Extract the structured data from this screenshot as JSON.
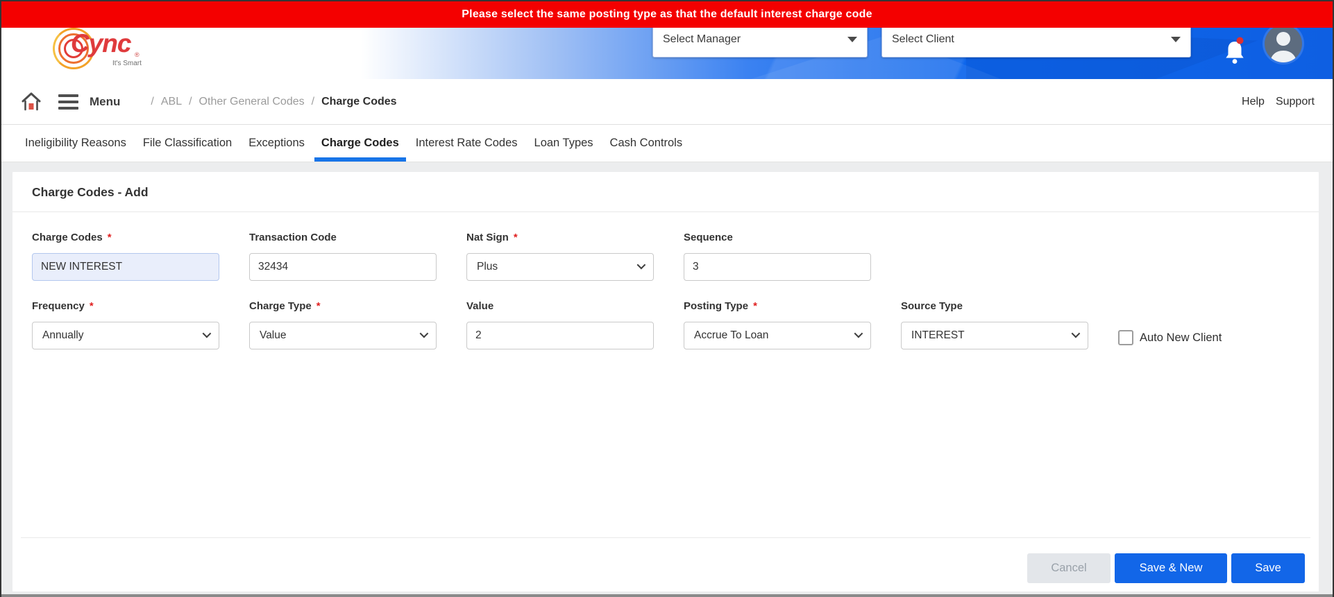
{
  "banner": {
    "message": "Please select the same posting type as that the default interest charge code"
  },
  "header": {
    "logo": {
      "brand": "Cync",
      "registered": "®",
      "tagline": "It's Smart"
    },
    "manager_select": {
      "value": "Select Manager"
    },
    "client_select": {
      "value": "Select Client"
    }
  },
  "breadcrumb": {
    "menu_label": "Menu",
    "separator": "/",
    "items": [
      {
        "label": "ABL"
      },
      {
        "label": "Other General Codes"
      },
      {
        "label": "Charge Codes"
      }
    ],
    "help": "Help",
    "support": "Support"
  },
  "tabs": [
    {
      "label": "Ineligibility Reasons",
      "active": false
    },
    {
      "label": "File Classification",
      "active": false
    },
    {
      "label": "Exceptions",
      "active": false
    },
    {
      "label": "Charge Codes",
      "active": true
    },
    {
      "label": "Interest Rate Codes",
      "active": false
    },
    {
      "label": "Loan Types",
      "active": false
    },
    {
      "label": "Cash Controls",
      "active": false
    }
  ],
  "panel": {
    "title": "Charge Codes - Add"
  },
  "form": {
    "required_marker": "*",
    "row1": [
      {
        "label": "Charge Codes",
        "required": true,
        "type": "input",
        "value": "NEW INTEREST"
      },
      {
        "label": "Transaction Code",
        "required": false,
        "type": "input",
        "value": "32434"
      },
      {
        "label": "Nat Sign",
        "required": true,
        "type": "select",
        "value": "Plus"
      },
      {
        "label": "Sequence",
        "required": false,
        "type": "input",
        "value": "3"
      }
    ],
    "row2": [
      {
        "label": "Frequency",
        "required": true,
        "type": "select",
        "value": "Annually"
      },
      {
        "label": "Charge Type",
        "required": true,
        "type": "select",
        "value": "Value"
      },
      {
        "label": "Value",
        "required": false,
        "type": "input",
        "value": "2"
      },
      {
        "label": "Posting Type",
        "required": true,
        "type": "select",
        "value": "Accrue To Loan"
      },
      {
        "label": "Source Type",
        "required": false,
        "type": "select",
        "value": "INTEREST"
      }
    ],
    "checkbox": {
      "label": "Auto New Client",
      "checked": false
    }
  },
  "footer": {
    "cancel": "Cancel",
    "save_new": "Save & New",
    "save": "Save"
  },
  "colors": {
    "banner_red": "#f40000",
    "accent_blue": "#1266e8",
    "active_tab_underline": "#1774e8",
    "focused_field_bg": "#e9eefb"
  }
}
